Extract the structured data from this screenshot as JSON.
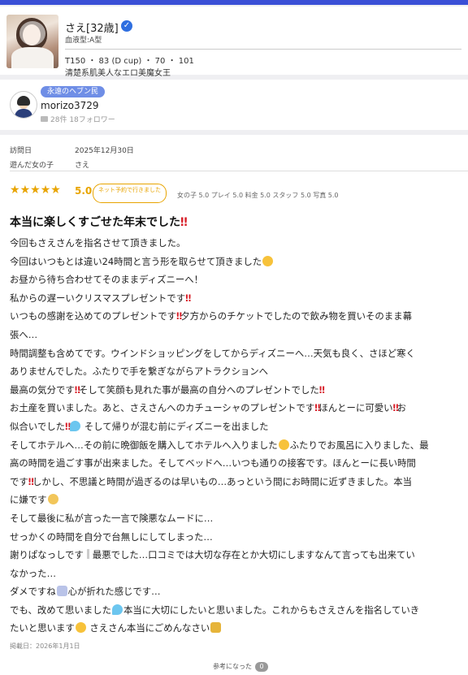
{
  "profile": {
    "name": "さえ[32歳]",
    "blood_type": "血液型:A型",
    "specs": "T150 ・ 83 (D cup) ・ 70 ・ 101",
    "catch_copy": "清楚系肌美人なエロ美魔女王"
  },
  "reviewer": {
    "badge": "永遠のヘブン民",
    "username": "morizo3729",
    "stats": "28件  18フォロワー"
  },
  "review": {
    "visit_label": "訪問日",
    "visit_date": "2025年12月30日",
    "girl_label": "遊んだ女の子",
    "girl_name": "さえ",
    "rating": {
      "stars": 5,
      "score": "5.0",
      "booking_note": "ネット予約で行きました",
      "sub_scores": "女の子 5.0  プレイ 5.0  料金 5.0  スタッフ 5.0  写真 5.0"
    },
    "title": "本当に楽しくすごせた年末でした",
    "lines": [
      {
        "a": "今回もさえさんを指名させて頂きました。"
      },
      {
        "a": "今回はいつもとは違い24時間と言う形を取らせて頂きました",
        "e1": "face"
      },
      {
        "a": "お昼から待ち合わせてそのままディズニーへ！"
      },
      {
        "a": "私からの遅ーいクリスマスプレゼントです",
        "bang1": "‼"
      },
      {
        "a": "いつもの感謝を込めてのプレゼントです",
        "bang1": "‼",
        "b": "夕方からのチケットでしたので飲み物を買いそのまま幕"
      },
      {
        "a": "張へ…"
      },
      {
        "a": "時間調整も含めてです。ウインドショッピングをしてからディズニーへ…天気も良く、さほど寒く"
      },
      {
        "a": "ありませんでした。ふたりで手を繋ぎながらアトラクションへ"
      },
      {
        "a": "最高の気分です",
        "bang1": "‼",
        "b": "そして笑顔も見れた事が最高の自分へのプレゼントでした",
        "bang2": "‼"
      },
      {
        "a": "お土産を買いました。あと、さえさんへのカチューシャのプレゼントです",
        "bang1": "‼",
        "b": "ほんとーに可愛い",
        "bang2": "‼",
        "c": "お"
      },
      {
        "a": "似合いでした",
        "bang1": "‼",
        "b": " そして帰りが混む前にディズニーを出ました",
        "e1": "sweat"
      },
      {
        "a": "そしてホテルへ…その前に晩御飯を購入してホテルへ入りました",
        "e1": "face",
        "b": "ふたりでお風呂に入りました、最"
      },
      {
        "a": "高の時間を過ごす事が出来ました。そしてベッドへ…いつも通りの接客です。ほんとーに長い時間"
      },
      {
        "a": "です",
        "bang1": "‼",
        "b": "しかし、不思議と時間が過ぎるのは早いもの…あっという間にお時間に近ずきました。本当"
      },
      {
        "a": "に嫌です",
        "e1": "tear"
      },
      {
        "a": "そして最後に私が言った一言で険悪なムードに…"
      },
      {
        "a": "せっかくの時間を自分で台無しにしてしまった…"
      },
      {
        "a": "謝りぱなっしです",
        "e1": "bolt",
        "b": "最悪でした…口コミでは大切な存在とか大切にしますなんて言っても出来てい"
      },
      {
        "a": "なかった…"
      },
      {
        "a": "ダメですね",
        "e1": "ghost",
        "b": "心が折れた感じです…"
      },
      {
        "a": "でも、改めて思いました",
        "e1": "sweat",
        "b": "本当に大切にしたいと思いました。これからもさえさんを指名していき"
      },
      {
        "a": "たいと思います",
        "e1": "face",
        "b": " さえさん本当にごめんなさい",
        "e2": "crown"
      }
    ],
    "posted": "掲載日：2026年1月1日",
    "helpful_label": "参考になった",
    "helpful_count": "0"
  },
  "colors": {
    "accent_bar": "#3a4fd6",
    "star": "#e8a400",
    "exclamation": "#d8202a",
    "badge": "#6f8ee6",
    "verified": "#2f6fe0"
  },
  "icons": [
    "verified-check-icon",
    "review-count-icon",
    "star-icon"
  ]
}
